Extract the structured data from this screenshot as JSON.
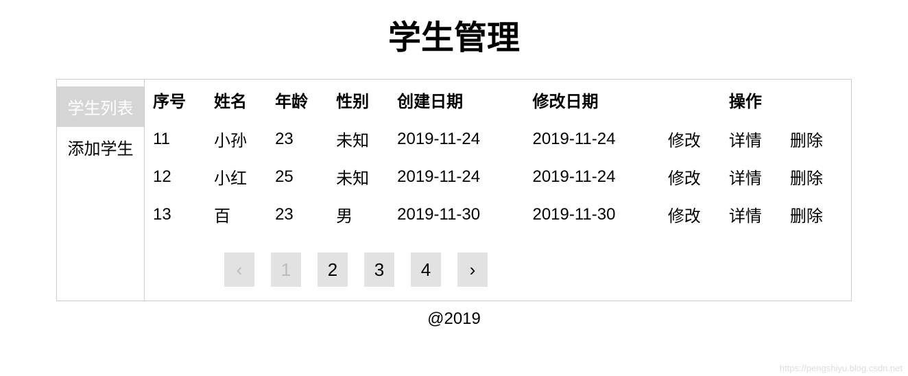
{
  "title": "学生管理",
  "sidebar": {
    "items": [
      {
        "label": "学生列表",
        "active": true
      },
      {
        "label": "添加学生",
        "active": false
      }
    ]
  },
  "table": {
    "headers": {
      "id": "序号",
      "name": "姓名",
      "age": "年龄",
      "gender": "性别",
      "created": "创建日期",
      "modified": "修改日期",
      "actions": "操作"
    },
    "rows": [
      {
        "id": "11",
        "name": "小孙",
        "age": "23",
        "gender": "未知",
        "created": "2019-11-24",
        "modified": "2019-11-24"
      },
      {
        "id": "12",
        "name": "小红",
        "age": "25",
        "gender": "未知",
        "created": "2019-11-24",
        "modified": "2019-11-24"
      },
      {
        "id": "13",
        "name": "百",
        "age": "23",
        "gender": "男",
        "created": "2019-11-30",
        "modified": "2019-11-30"
      }
    ],
    "actions": {
      "edit": "修改",
      "detail": "详情",
      "delete": "删除"
    }
  },
  "pagination": {
    "prev": "‹",
    "next": "›",
    "pages": [
      "1",
      "2",
      "3",
      "4"
    ],
    "current": "1"
  },
  "footer": "@2019",
  "watermark": "https://pengshiyu.blog.csdn.net"
}
